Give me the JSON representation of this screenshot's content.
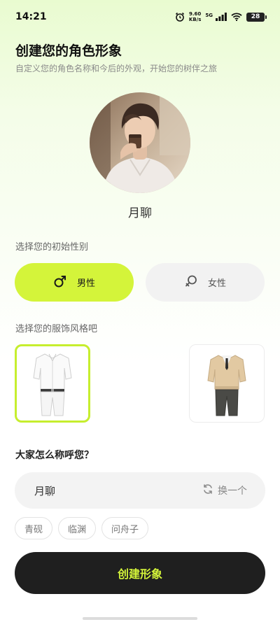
{
  "status_bar": {
    "time": "14:21",
    "net_speed_value": "9.60",
    "net_speed_unit": "KB/s",
    "signal_label": "5G",
    "battery": "28"
  },
  "header": {
    "title": "创建您的角色形象",
    "subtitle": "自定义您的角色名称和今后的外观，开始您的树伴之旅"
  },
  "avatar": {
    "name": "月聊"
  },
  "gender": {
    "label": "选择您的初始性别",
    "male_label": "男性",
    "female_label": "女性",
    "selected": "male",
    "accent_color": "#d4f43a"
  },
  "outfit": {
    "label": "选择您的服饰风格吧",
    "options": [
      {
        "name": "white-shirt-outfit",
        "selected": true
      },
      {
        "name": "sweater-outfit",
        "selected": false
      }
    ]
  },
  "nickname": {
    "question": "大家怎么称呼您？",
    "value": "月聊",
    "shuffle_label": "换一个",
    "suggestions": [
      "青砚",
      "临渊",
      "问舟子"
    ]
  },
  "actions": {
    "create_label": "创建形象"
  }
}
